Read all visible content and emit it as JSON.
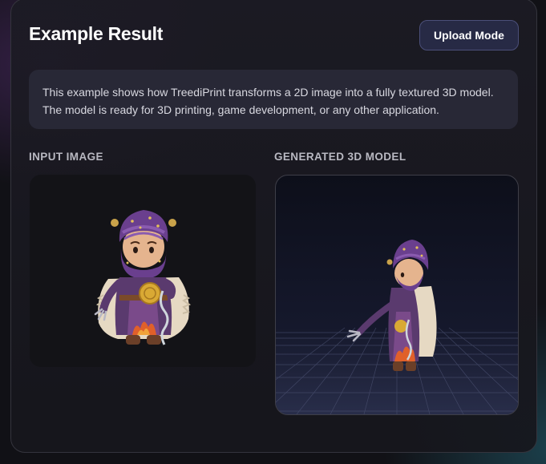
{
  "card": {
    "title": "Example Result",
    "upload_button_label": "Upload Mode"
  },
  "info": {
    "text": "This example shows how TreediPrint transforms a 2D image into a fully textured 3D model. The model is ready for 3D printing, game development, or any other application."
  },
  "sections": {
    "input_label": "INPUT IMAGE",
    "model_label": "GENERATED 3D MODEL"
  },
  "colors": {
    "accent_button_bg": "#272a45",
    "accent_button_border": "#4b4f79",
    "card_border": "#34343d",
    "info_bg": "#282836"
  },
  "images": {
    "input_image": "wizard-character-2d",
    "generated_model": "wizard-character-3d-on-grid"
  }
}
